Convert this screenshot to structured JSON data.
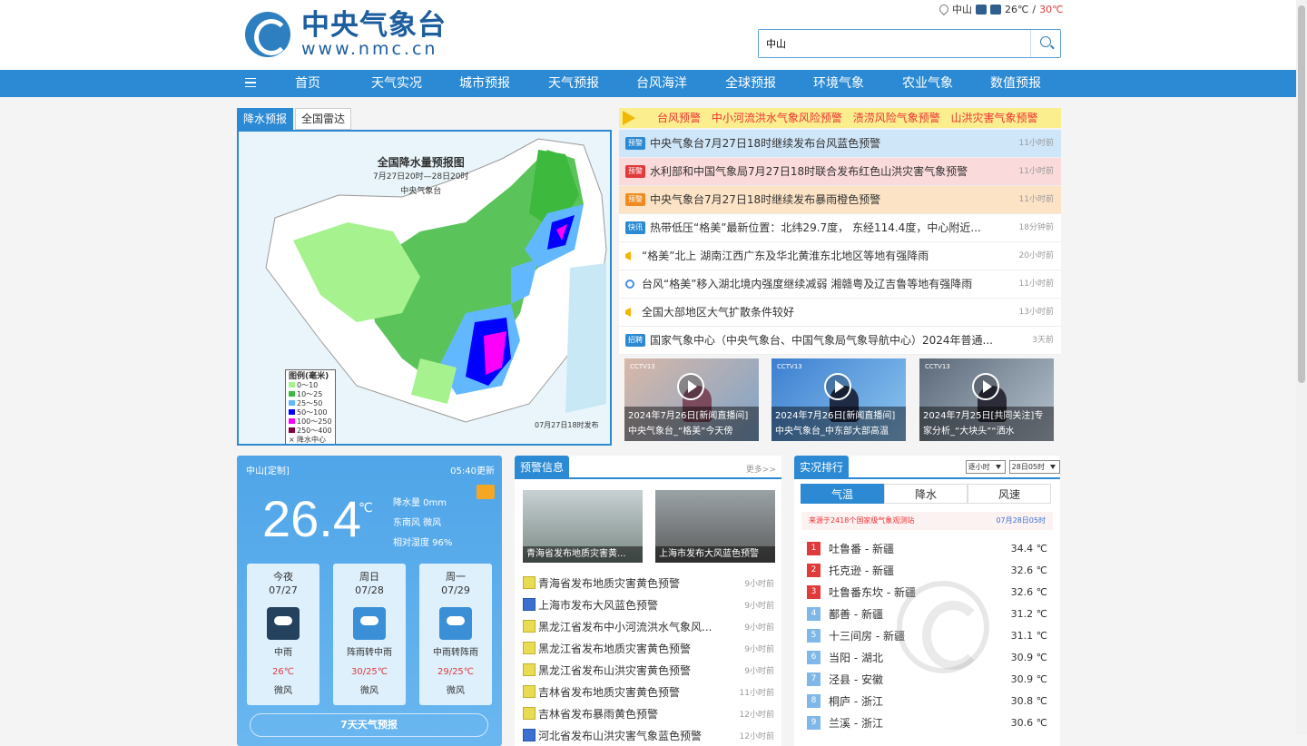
{
  "header": {
    "logo_cn": "中央气象台",
    "logo_en": "www.nmc.cn",
    "location": "中山",
    "temp_low": "26℃",
    "temp_sep": "/",
    "temp_high": "30℃",
    "search_value": "中山"
  },
  "nav": {
    "items": [
      "首页",
      "天气实况",
      "城市预报",
      "天气预报",
      "台风海洋",
      "全球预报",
      "环境气象",
      "农业气象",
      "数值预报"
    ]
  },
  "map": {
    "tabs": [
      "降水预报",
      "全国雷达"
    ],
    "title": "全国降水量预报图",
    "subtitle": "7月27日20时—28日20时",
    "issuer": "中央气象台",
    "legend_title": "图例(毫米)",
    "legend": [
      {
        "label": "0～10",
        "color": "#a6f28f"
      },
      {
        "label": "10～25",
        "color": "#3dba3d"
      },
      {
        "label": "25～50",
        "color": "#61b8ff"
      },
      {
        "label": "50～100",
        "color": "#0000ff"
      },
      {
        "label": "100～250",
        "color": "#fa00fa"
      },
      {
        "label": "250～400",
        "color": "#800040"
      },
      {
        "label": "降水中心值",
        "color": ""
      }
    ],
    "foot": "07月27日18时发布"
  },
  "warnbar": {
    "items": [
      "台风预警",
      "中小河流洪水气象风险预警",
      "渍涝风险气象预警",
      "山洪灾害气象预警"
    ]
  },
  "news": [
    {
      "tag": "预警",
      "tag_color": "#2b8ad3",
      "bg": "#cfe5f8",
      "text": "中央气象台7月27日18时继续发布台风蓝色预警",
      "time": "11小时前"
    },
    {
      "tag": "预警",
      "tag_color": "#e03a3a",
      "bg": "#fadada",
      "text": "水利部和中国气象局7月27日18时联合发布红色山洪灾害气象预警",
      "time": "11小时前"
    },
    {
      "tag": "预警",
      "tag_color": "#f08a1e",
      "bg": "#fde3c6",
      "text": "中央气象台7月27日18时继续发布暴雨橙色预警",
      "time": "11小时前"
    },
    {
      "tag": "快讯",
      "tag_color": "#2b8ad3",
      "bg": "#ffffff",
      "text": "热带低压“格美”最新位置：北纬29.7度， 东经114.4度，中心附近...",
      "time": "18分钟前"
    },
    {
      "tag": "",
      "icon": "megaphone-icon",
      "bg": "#ffffff",
      "text": "“格美”北上 湖南江西广东及华北黄淮东北地区等地有强降雨",
      "time": "20小时前"
    },
    {
      "tag": "",
      "icon": "location-icon",
      "bg": "#ffffff",
      "text": "台风“格美”移入湖北境内强度继续减弱 湘赣粤及辽吉鲁等地有强降雨",
      "time": "11小时前"
    },
    {
      "tag": "",
      "icon": "megaphone-icon",
      "bg": "#ffffff",
      "text": "全国大部地区大气扩散条件较好",
      "time": "13小时前"
    },
    {
      "tag": "招聘",
      "tag_color": "#2b8ad3",
      "bg": "#ffffff",
      "text": "国家气象中心（中央气象台、中国气象局气象导航中心）2024年普通...",
      "time": "3天前"
    }
  ],
  "videos": [
    {
      "cap1": "2024年7月26日[新闻直播间]",
      "cap2": "中央气象台_“格美”今天傍",
      "logo": "CCTV13"
    },
    {
      "cap1": "2024年7月26日[新闻直播间]",
      "cap2": "中央气象台_中东部大部高温",
      "logo": "CCTV13"
    },
    {
      "cap1": "2024年7月25日[共同关注]专",
      "cap2": "家分析_“大块头”“洒水",
      "logo": "CCTV13"
    }
  ],
  "weather": {
    "location": "中山[定制]",
    "updated": "05:40更新",
    "temp": "26.4",
    "unit": "℃",
    "rain": "降水量 0mm",
    "wind": "东南风 微风",
    "humidity": "相对湿度 96%",
    "days": [
      {
        "name": "今夜",
        "date": "07/27",
        "desc": "中雨",
        "temp": "26℃",
        "wind": "微风"
      },
      {
        "name": "周日",
        "date": "07/28",
        "desc": "阵雨转中雨",
        "temp": "30/25℃",
        "wind": "微风"
      },
      {
        "name": "周一",
        "date": "07/29",
        "desc": "中雨转阵雨",
        "temp": "29/25℃",
        "wind": "微风"
      }
    ],
    "button": "7天天气预报"
  },
  "warninfo": {
    "title": "预警信息",
    "more": "更多>>",
    "images": [
      "青海省发布地质灾害黄...",
      "上海市发布大风蓝色预警"
    ],
    "items": [
      {
        "text": "青海省发布地质灾害黄色预警",
        "time": "9小时前",
        "color": "yellow"
      },
      {
        "text": "上海市发布大风蓝色预警",
        "time": "9小时前",
        "color": "blue"
      },
      {
        "text": "黑龙江省发布中小河流洪水气象风...",
        "time": "9小时前",
        "color": "yellow"
      },
      {
        "text": "黑龙江省发布地质灾害黄色预警",
        "time": "9小时前",
        "color": "yellow"
      },
      {
        "text": "黑龙江省发布山洪灾害黄色预警",
        "time": "9小时前",
        "color": "yellow"
      },
      {
        "text": "吉林省发布地质灾害黄色预警",
        "time": "11小时前",
        "color": "yellow"
      },
      {
        "text": "吉林省发布暴雨黄色预警",
        "time": "12小时前",
        "color": "yellow"
      },
      {
        "text": "河北省发布山洪灾害气象蓝色预警",
        "time": "12小时前",
        "color": "blue"
      }
    ]
  },
  "ranking": {
    "title": "实况排行",
    "select1": "逐小时",
    "select2": "28日05时",
    "tabs": [
      "气温",
      "降水",
      "风速"
    ],
    "source": "来源于2418个国家级气象观测站",
    "time": "07月28日05时",
    "items": [
      {
        "rank": "1",
        "name": "吐鲁番 - 新疆",
        "value": "34.4 ℃",
        "color": "#e03a3a"
      },
      {
        "rank": "2",
        "name": "托克逊 - 新疆",
        "value": "32.6 ℃",
        "color": "#e03a3a"
      },
      {
        "rank": "3",
        "name": "吐鲁番东坎 - 新疆",
        "value": "32.6 ℃",
        "color": "#e03a3a"
      },
      {
        "rank": "4",
        "name": "鄯善 - 新疆",
        "value": "31.2 ℃",
        "color": "#7fb8e8"
      },
      {
        "rank": "5",
        "name": "十三间房 - 新疆",
        "value": "31.1 ℃",
        "color": "#7fb8e8"
      },
      {
        "rank": "6",
        "name": "当阳 - 湖北",
        "value": "30.9 ℃",
        "color": "#7fb8e8"
      },
      {
        "rank": "7",
        "name": "泾县 - 安徽",
        "value": "30.9 ℃",
        "color": "#7fb8e8"
      },
      {
        "rank": "8",
        "name": "桐庐 - 浙江",
        "value": "30.8 ℃",
        "color": "#7fb8e8"
      },
      {
        "rank": "9",
        "name": "兰溪 - 浙江",
        "value": "30.6 ℃",
        "color": "#7fb8e8"
      }
    ]
  }
}
